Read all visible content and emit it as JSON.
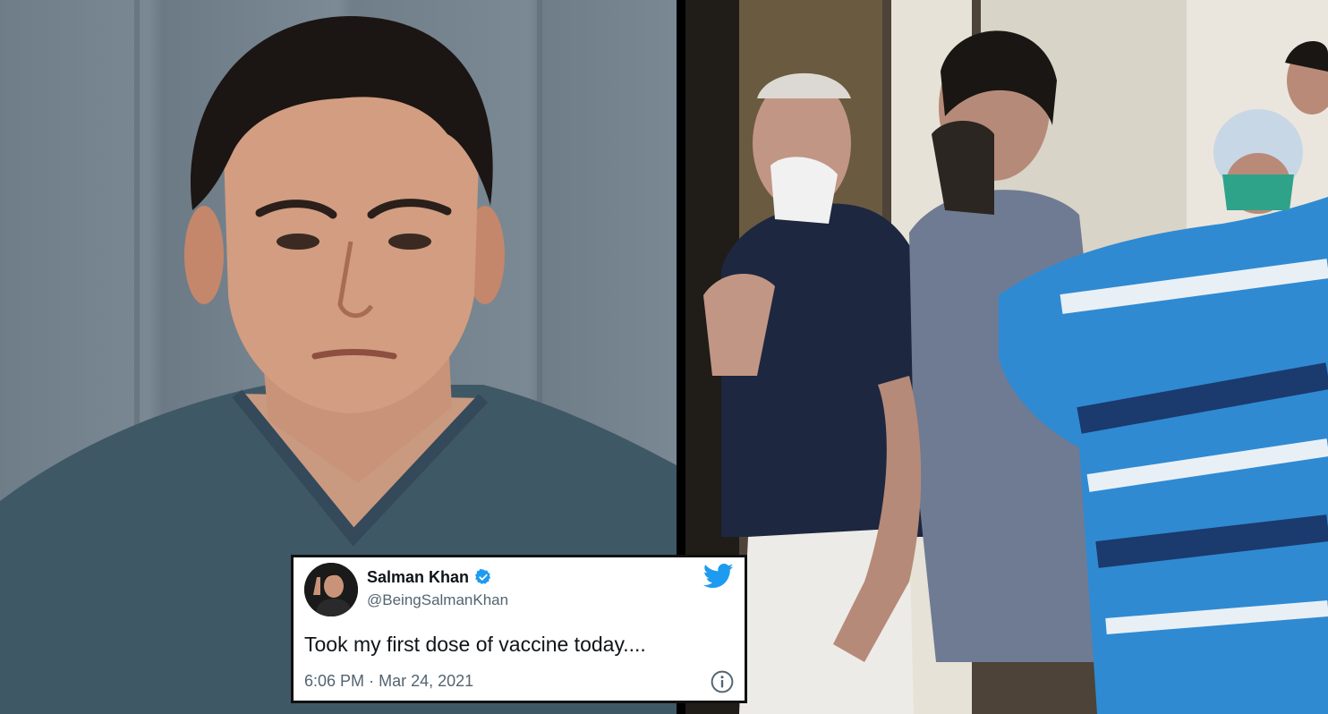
{
  "tweet": {
    "name": "Salman Khan",
    "handle": "@BeingSalmanKhan",
    "text": "Took my first dose of vaccine today....",
    "time": "6:06 PM",
    "separator": "·",
    "date": "Mar 24, 2021"
  },
  "icons": {
    "verified": "verified-badge-icon",
    "brand": "twitter-bird-icon",
    "info": "info-icon"
  },
  "colors": {
    "twitter_blue": "#1d9bf0",
    "text_primary": "#0f1419",
    "text_secondary": "#536471"
  }
}
